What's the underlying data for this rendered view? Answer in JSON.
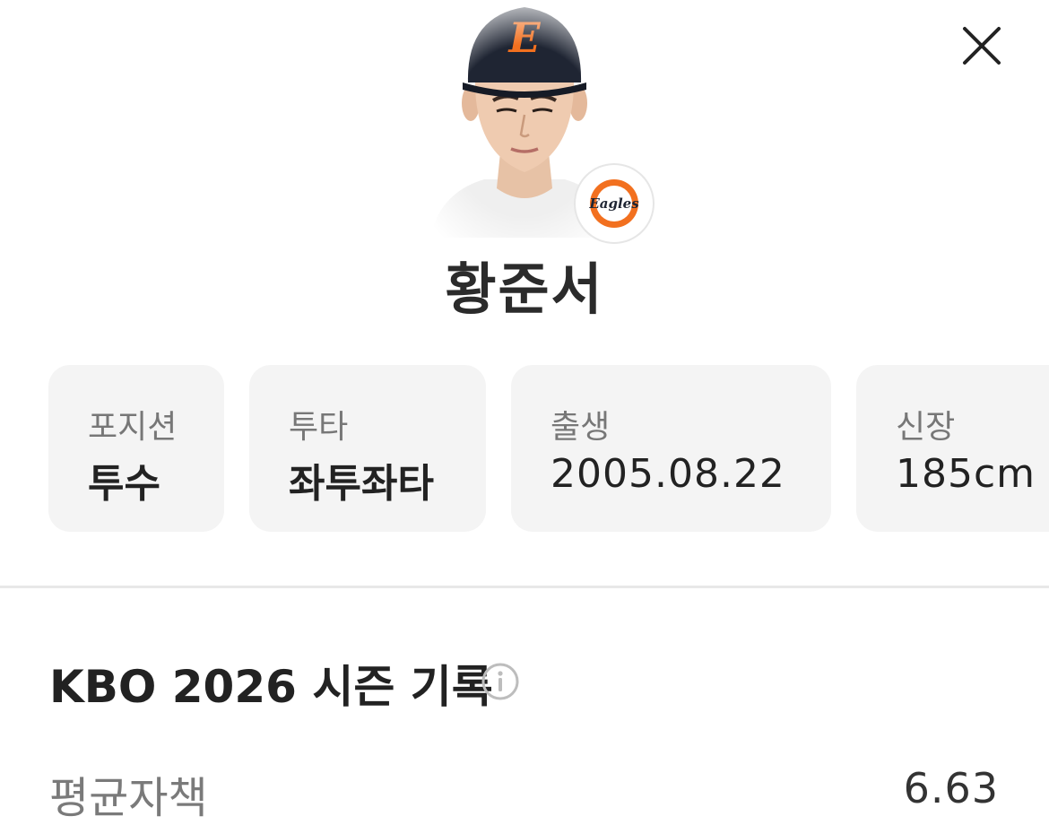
{
  "player": {
    "name": "황준서",
    "team_logo_text": "Eagles",
    "cap_letter": "E"
  },
  "info_cards": [
    {
      "label": "포지션",
      "value": "투수"
    },
    {
      "label": "투타",
      "value": "좌투좌타"
    },
    {
      "label": "출생",
      "value": "2005.08.22"
    },
    {
      "label": "신장",
      "value": "185cm"
    }
  ],
  "section": {
    "title": "KBO 2026 시즌 기록"
  },
  "stats": [
    {
      "label": "평균자책",
      "value": "6.63"
    }
  ],
  "icons": {
    "close": "close-icon",
    "info": "info-icon"
  },
  "colors": {
    "team_orange": "#f2701f",
    "cap_navy": "#1f2533",
    "card_bg": "#f4f4f4"
  }
}
